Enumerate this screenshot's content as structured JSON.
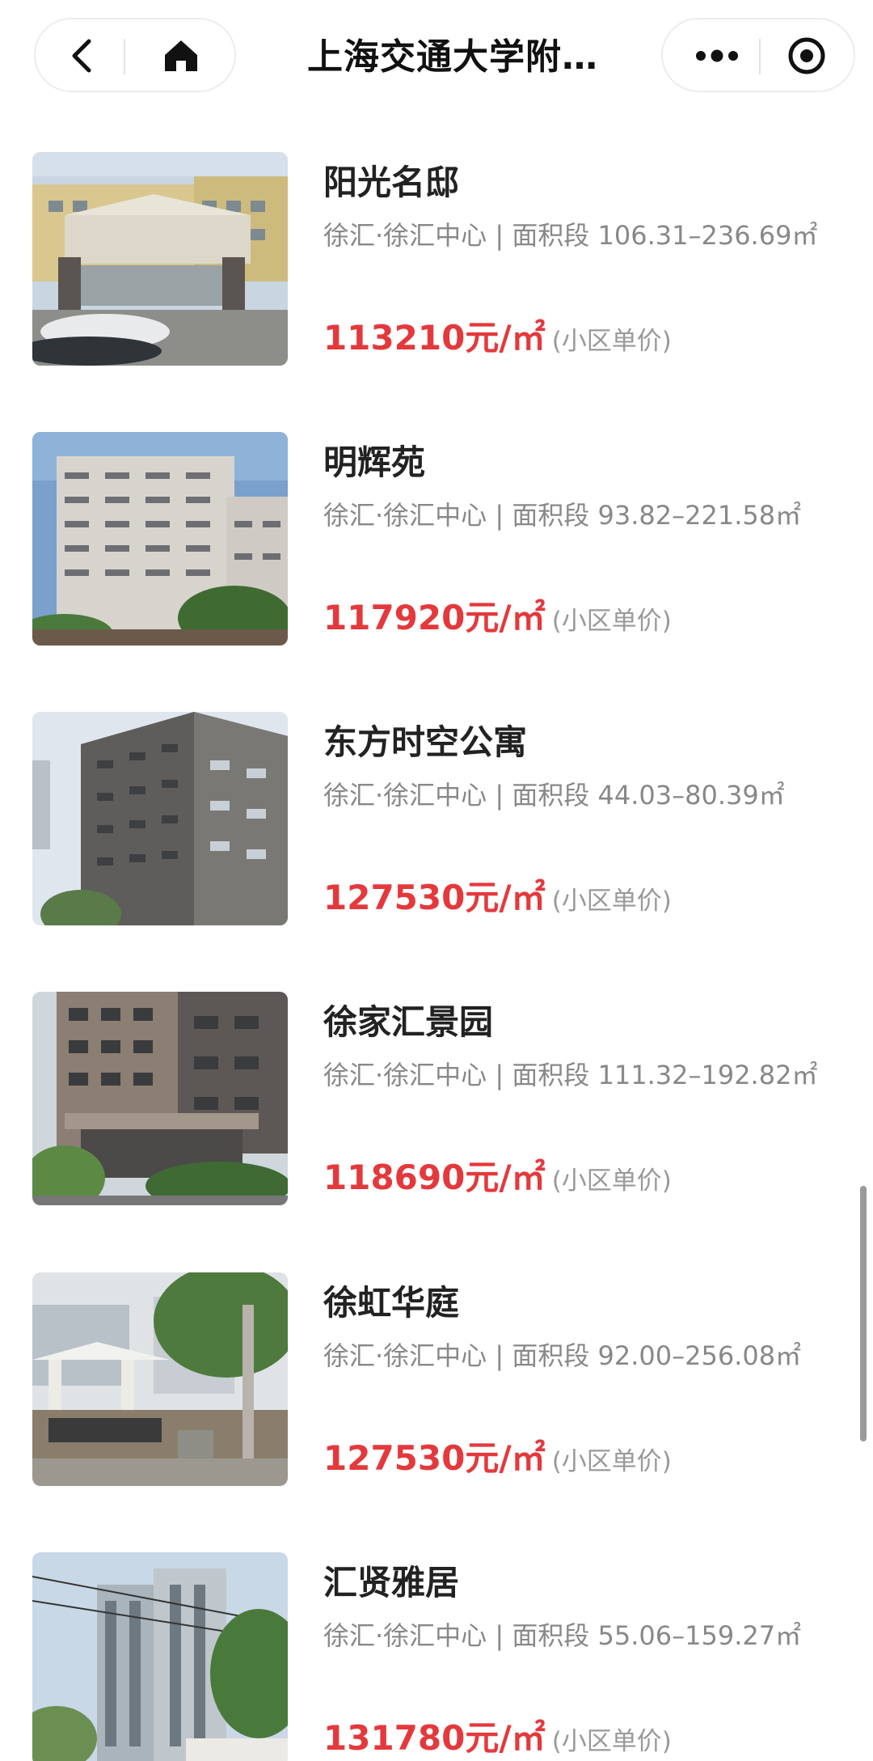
{
  "navbar": {
    "title": "上海交通大学附…",
    "back_icon": "chevron-left-icon",
    "home_icon": "home-icon",
    "more_icon": "more-dots-icon",
    "close_icon": "target-close-icon"
  },
  "listings": [
    {
      "name": "阳光名邸",
      "district": "徐汇·徐汇中心",
      "area_label": "面积段",
      "area_range": "106.31–236.69㎡",
      "price": "113210元/㎡",
      "price_note": "(小区单价)"
    },
    {
      "name": "明辉苑",
      "district": "徐汇·徐汇中心",
      "area_label": "面积段",
      "area_range": "93.82–221.58㎡",
      "price": "117920元/㎡",
      "price_note": "(小区单价)"
    },
    {
      "name": "东方时空公寓",
      "district": "徐汇·徐汇中心",
      "area_label": "面积段",
      "area_range": "44.03–80.39㎡",
      "price": "127530元/㎡",
      "price_note": "(小区单价)"
    },
    {
      "name": "徐家汇景园",
      "district": "徐汇·徐汇中心",
      "area_label": "面积段",
      "area_range": "111.32–192.82㎡",
      "price": "118690元/㎡",
      "price_note": "(小区单价)"
    },
    {
      "name": "徐虹华庭",
      "district": "徐汇·徐汇中心",
      "area_label": "面积段",
      "area_range": "92.00–256.08㎡",
      "price": "127530元/㎡",
      "price_note": "(小区单价)"
    },
    {
      "name": "汇贤雅居",
      "district": "徐汇·徐汇中心",
      "area_label": "面积段",
      "area_range": "55.06–159.27㎡",
      "price": "131780元/㎡",
      "price_note": "(小区单价)"
    }
  ],
  "colors": {
    "price": "#e4393c",
    "meta": "#888888",
    "title": "#222222"
  }
}
